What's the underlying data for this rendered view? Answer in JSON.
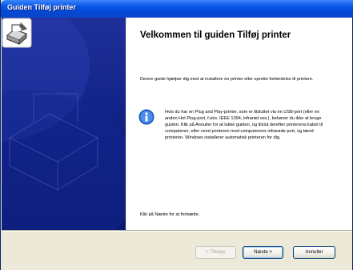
{
  "window": {
    "title": "Guiden Tilføj printer"
  },
  "wizard": {
    "heading": "Velkommen til guiden Tilføj printer",
    "intro": "Denne guide hjælper dig med at installere en printer eller oprette forbindelse til printere.",
    "info": "Hvis du har en Plug and Play-printer, som er tilsluttet via en USB-port (eller en anden Hot Plug-port, f.eks. IEEE 1394, infrarød osv.), behøver du ikke at bruge guiden. Klik på Annuller for at lukke guiden, og tilslut derefter printerens kabel til computeren, eller vend printeren mod computerens infrarøde port, og tænd printeren. Windows installerer automatisk printeren for dig.",
    "next_hint": "Klik på Næste for at fortsætte.",
    "side_icon": "printer-wizard-icon",
    "info_icon": "info-icon"
  },
  "buttons": {
    "back": "< Tilbage",
    "next": "Næste >",
    "cancel": "Annuller"
  },
  "colors": {
    "titlebar": "#0a58e6",
    "side_panel": "#0d1f80",
    "dialog_bg": "#ece9d8"
  }
}
